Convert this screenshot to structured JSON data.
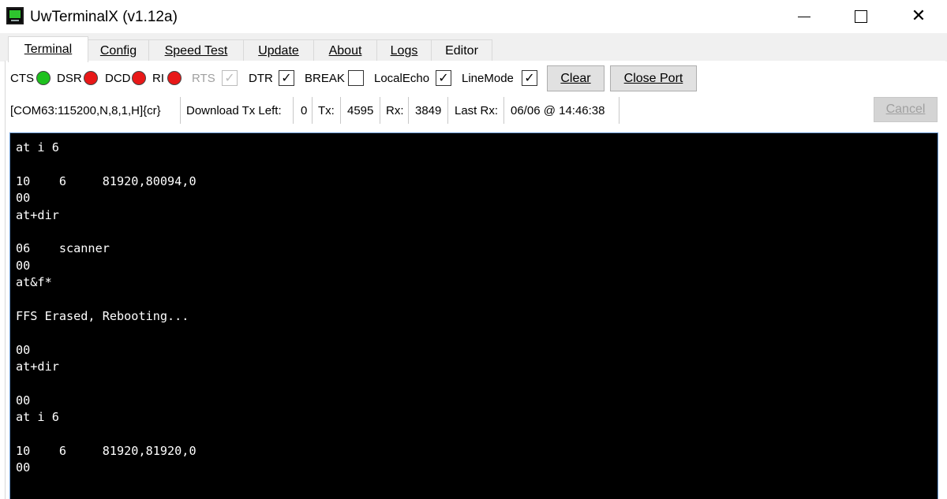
{
  "window": {
    "title": "UwTerminalX (v1.12a)",
    "icon": "terminal-app-icon",
    "minimize_glyph": "",
    "close_glyph": "✕"
  },
  "tabs": [
    {
      "label": "Terminal",
      "active": true
    },
    {
      "label": "Config",
      "active": false
    },
    {
      "label": "Speed Test",
      "active": false
    },
    {
      "label": "Update",
      "active": false
    },
    {
      "label": "About",
      "active": false
    },
    {
      "label": "Logs",
      "active": false
    },
    {
      "label": "Editor",
      "active": false
    }
  ],
  "signals": {
    "cts": {
      "label": "CTS",
      "color": "#1ec11e"
    },
    "dsr": {
      "label": "DSR",
      "color": "#e81818"
    },
    "dcd": {
      "label": "DCD",
      "color": "#e81818"
    },
    "ri": {
      "label": "RI",
      "color": "#e81818"
    }
  },
  "toggles": {
    "rts": {
      "label": "RTS",
      "checked": true,
      "enabled": false
    },
    "dtr": {
      "label": "DTR",
      "checked": true,
      "enabled": true
    },
    "break": {
      "label": "BREAK",
      "checked": false,
      "enabled": true
    },
    "local_echo": {
      "label": "LocalEcho",
      "checked": true,
      "enabled": true
    },
    "line_mode": {
      "label": "LineMode",
      "checked": true,
      "enabled": true
    },
    "check_glyph": "✓"
  },
  "buttons": {
    "clear": "Clear",
    "close_port": "Close Port",
    "cancel": "Cancel"
  },
  "status": {
    "port": "[COM63:115200,N,8,1,H]{cr}",
    "download_label": "Download Tx Left:",
    "download_value": "0",
    "tx_label": "Tx:",
    "tx_value": "4595",
    "rx_label": "Rx:",
    "rx_value": "3849",
    "last_rx_label": "Last Rx:",
    "last_rx_value": "06/06 @ 14:46:38"
  },
  "terminal": {
    "lines": [
      "at i 6",
      "",
      "10    6     81920,80094,0",
      "00",
      "at+dir",
      "",
      "06    scanner",
      "00",
      "at&f*",
      "",
      "FFS Erased, Rebooting...",
      "",
      "00",
      "at+dir",
      "",
      "00",
      "at i 6",
      "",
      "10    6     81920,81920,0",
      "00"
    ]
  },
  "colors": {
    "terminal_bg": "#000000",
    "terminal_fg": "#ffffff",
    "led_on": "#1ec11e",
    "led_off": "#e81818"
  }
}
